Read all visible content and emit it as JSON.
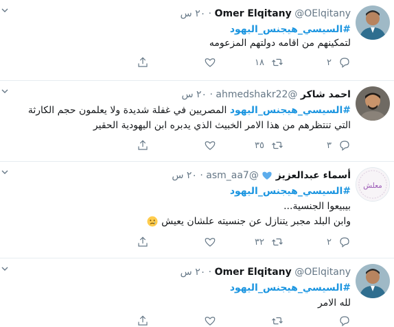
{
  "tweets": [
    {
      "name": "Omer Elqitany",
      "handle": "@OElqitany",
      "time": "٢٠ س",
      "hashtag": "#السيسي_هيجنس_اليهود",
      "lines": [
        "لتمكينهم من اقامه دولتهم المزعومه"
      ],
      "retweets": "١٨",
      "replies": "٢",
      "avatar_icon": "profile-photo-man-icon"
    },
    {
      "name": "احمد شاكر",
      "handle": "@ahmedshakr22",
      "time": "٢٠ س",
      "hashtag": "#السيسي_هيجنس_اليهود",
      "hashtag_suffix": " المصريين في غفلة شديدة ولا يعلمون حجم الكارثة",
      "lines": [
        "التي تنتظرهم من هذا الامر الخبيث الذي يدبره ابن اليهودية الحقير"
      ],
      "retweets": "٣٥",
      "replies": "٣",
      "avatar_icon": "profile-photo-man-icon"
    },
    {
      "name": "أسماء عبدالعزيز",
      "handle": "@asm_aa7",
      "time": "٢٠ س",
      "hashtag": "#السيسي_هيجنس_اليهود",
      "lines": [
        "بيبيعوا الجنسية...",
        "وابن البلد مجبر يتنازل عن جنسيته علشان يعيش"
      ],
      "retweets": "٣٢",
      "replies": "٢",
      "avatar_text": "معلش",
      "avatar_icon": "profile-logo-icon",
      "name_emoji": "blue-heart-icon",
      "line_emoji": "crying-face-icon"
    },
    {
      "name": "Omer Elqitany",
      "handle": "@OElqitany",
      "time": "٢٠ س",
      "hashtag": "#السيسي_هيجنس_اليهود",
      "lines": [
        "لله الامر"
      ],
      "avatar_icon": "profile-photo-man-icon"
    }
  ],
  "colors": {
    "link": "#1b95e0",
    "muted": "#657786",
    "border": "#e6ecf0"
  }
}
